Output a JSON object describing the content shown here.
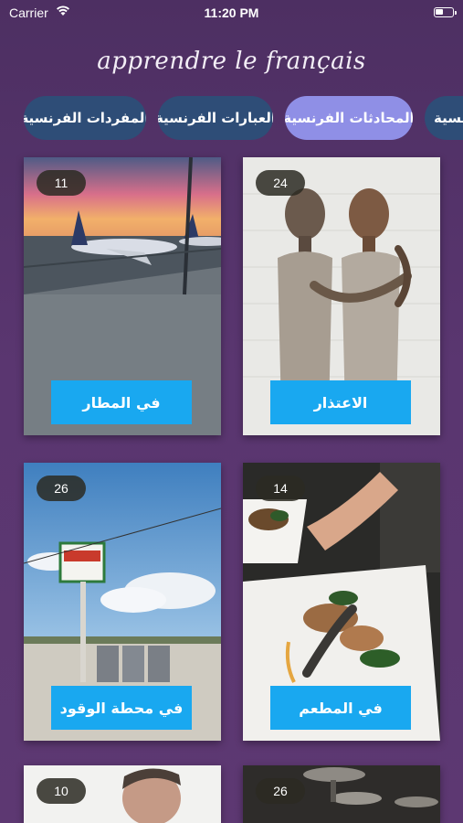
{
  "status_bar": {
    "carrier": "Carrier",
    "time": "11:20 PM"
  },
  "header": {
    "title": "apprendre le français"
  },
  "tabs": [
    {
      "label": "المفردات الفرنسية",
      "active": false
    },
    {
      "label": "العبارات الفرنسية",
      "active": false
    },
    {
      "label": "المحادثات الفرنسية",
      "active": true
    },
    {
      "label": "نسية",
      "active": false
    }
  ],
  "cards": [
    {
      "count": "11",
      "label": "في المطار"
    },
    {
      "count": "24",
      "label": "الاعتذار"
    },
    {
      "count": "26",
      "label": "في محطة الوقود"
    },
    {
      "count": "14",
      "label": "في المطعم"
    },
    {
      "count": "10",
      "label": ""
    },
    {
      "count": "26",
      "label": ""
    }
  ],
  "colors": {
    "tab": "#2e4d77",
    "tab_active": "#8f8fe6",
    "label_button": "#19a8f0"
  }
}
